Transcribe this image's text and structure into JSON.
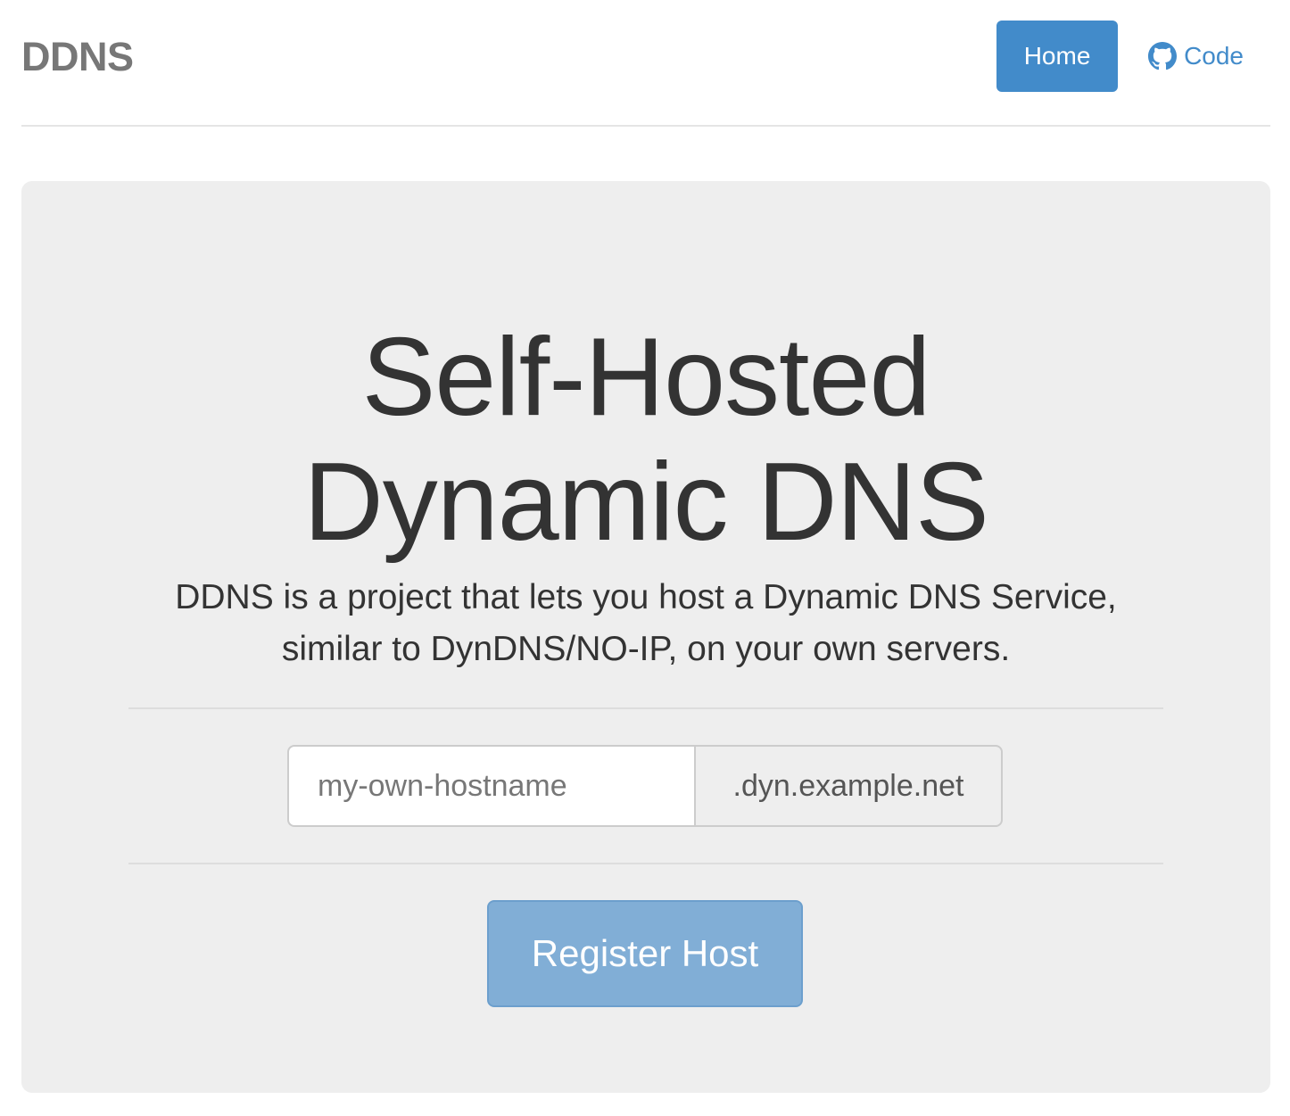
{
  "header": {
    "brand": "DDNS",
    "nav": {
      "home_label": "Home",
      "code_label": "Code",
      "code_icon": "github-icon"
    }
  },
  "jumbotron": {
    "title_lines": [
      "Self-Hosted",
      "Dynamic DNS"
    ],
    "lead_lines": [
      "DDNS is a project that lets you host a Dynamic DNS Service,",
      "similar to DynDNS/NO-IP, on your own servers."
    ],
    "hostname_input": {
      "value": "",
      "placeholder": "my-own-hostname"
    },
    "domain_suffix": ".dyn.example.net",
    "register_label": "Register Host"
  },
  "colors": {
    "primary": "#428bca",
    "primary_disabled": "#81aed6",
    "jumbotron_bg": "#eeeeee",
    "brand_text": "#777777"
  }
}
